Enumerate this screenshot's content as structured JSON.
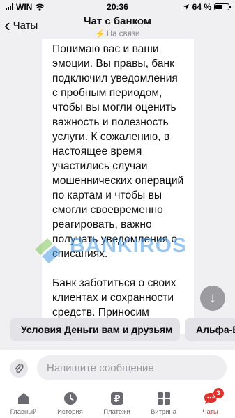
{
  "status_bar": {
    "carrier": "WIN",
    "time": "20:36",
    "battery": "64 %",
    "battery_level": 0.64
  },
  "header": {
    "back_label": "Чаты",
    "title": "Чат с банком",
    "subtitle": "На связи"
  },
  "message": {
    "paragraphs": [
      "Понимаю вас и ваши эмоции. Вы правы, банк подключил уведомления с пробным периодом, чтобы вы могли оценить важность и полезность услуги. К сожалению, в настоящее время участились случаи мошеннических операций по картам и чтобы вы смогли своевременно реагировать, важно получать уведомления о списаниях.",
      "Банк заботиться о своих клиентах и сохранности средств. Приносим извинения, если расстроили неудобства, мы этого не"
    ]
  },
  "watermark": "BANKIROS",
  "quick_replies": [
    "Условия Деньги вам и друзьям",
    "Альфа-В"
  ],
  "composer": {
    "placeholder": "Напишите сообщение"
  },
  "tabbar": {
    "items": [
      {
        "label": "Главный",
        "icon": "home-icon"
      },
      {
        "label": "История",
        "icon": "clock-icon"
      },
      {
        "label": "Платежи",
        "icon": "ruble-icon"
      },
      {
        "label": "Витрина",
        "icon": "grid-icon"
      },
      {
        "label": "Чаты",
        "icon": "chat-icon",
        "badge": "3",
        "active": true
      }
    ]
  },
  "colors": {
    "accent": "#e0322a",
    "online": "#2cb56b",
    "watermark": "#4a9be3"
  }
}
